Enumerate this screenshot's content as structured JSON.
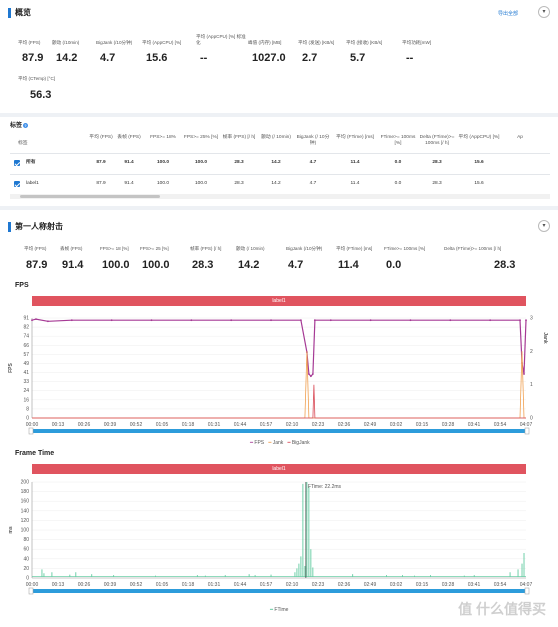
{
  "overview": {
    "title": "概览",
    "export_label": "导出全部",
    "metrics_row1": [
      {
        "label": "平均 (FPS)",
        "value": "87.9"
      },
      {
        "label": "颤动 (/10min)",
        "value": "14.2"
      },
      {
        "label": "BigJank (/10分钟)",
        "value": "4.7"
      },
      {
        "label": "平均 (AppCPU) [%]",
        "value": "15.6"
      },
      {
        "label": "平均 (AppCPU) [%] 标准化",
        "value": "--"
      },
      {
        "label": "峰值 (内存) [MB]",
        "value": "1027.0"
      },
      {
        "label": "平均 (发送) [KB/s]",
        "value": "2.7"
      },
      {
        "label": "平均 (接收) [KB/s]",
        "value": "5.7"
      },
      {
        "label": "平均功耗[mW]",
        "value": "--"
      }
    ],
    "metrics_row2": [
      {
        "label": "平均 (CTemp) [°C]",
        "value": "56.3"
      }
    ]
  },
  "tags": {
    "title": "标签",
    "headers": [
      "标签",
      "平均 (FPS)",
      "丢帧 (FPS)",
      "FPS>= 18%",
      "FPS>= 25% [%]",
      "帧率 (FPS) [/ h]",
      "颤动 (/ 10min)",
      "BigJank (/ 10分钟)",
      "平均 (FTime) [ms]",
      "FTime>= 100ms [%]",
      "Delta (FTime)>= 100ms [/ h]",
      "平均 (AppCPU) [%]",
      "Ap"
    ],
    "rows": [
      {
        "label": "所有",
        "bold": true,
        "cells": [
          "87.9",
          "91.4",
          "100.0",
          "100.0",
          "28.3",
          "14.2",
          "4.7",
          "11.4",
          "0.0",
          "28.3",
          "15.6"
        ]
      },
      {
        "label": "label1",
        "bold": false,
        "cells": [
          "87.9",
          "91.4",
          "100.0",
          "100.0",
          "28.3",
          "14.2",
          "4.7",
          "11.4",
          "0.0",
          "28.3",
          "15.6"
        ]
      }
    ]
  },
  "session": {
    "title": "第一人称射击",
    "metrics": [
      {
        "label": "平均 (FPS)",
        "value": "87.9"
      },
      {
        "label": "丢帧 (FPS)",
        "value": "91.4"
      },
      {
        "label": "FPS>= 18 [%]",
        "value": "100.0"
      },
      {
        "label": "FPS>= 25 [%]",
        "value": "100.0"
      },
      {
        "label": "帧率 (FPS) [/ h]",
        "value": "28.3"
      },
      {
        "label": "颤动 (/ 10min)",
        "value": "14.2"
      },
      {
        "label": "BigJank (/10分钟)",
        "value": "4.7"
      },
      {
        "label": "平均 (FTime) [ms]",
        "value": "11.4"
      },
      {
        "label": "FTime>= 100ms [%]",
        "value": "0.0"
      },
      {
        "label": "Delta (FTime)>= 100ms [/ h]",
        "value": "28.3"
      }
    ]
  },
  "chart_data": [
    {
      "type": "line",
      "title": "FPS",
      "banner": "label1",
      "ylabel": "FPS",
      "ylabel_right": "Jank",
      "yticks": [
        "0",
        "8",
        "16",
        "24",
        "33",
        "41",
        "49",
        "57",
        "66",
        "74",
        "82",
        "91"
      ],
      "yticks_right": [
        "0",
        "1",
        "2",
        "3"
      ],
      "xticks": [
        "00:00",
        "00:13",
        "00:26",
        "00:39",
        "00:52",
        "01:05",
        "01:18",
        "01:31",
        "01:44",
        "01:57",
        "02:10",
        "02:23",
        "02:36",
        "02:49",
        "03:02",
        "03:15",
        "03:28",
        "03:41",
        "03:54",
        "04:07"
      ],
      "series": [
        {
          "name": "FPS",
          "color": "#a63a95",
          "points": [
            [
              0,
              89
            ],
            [
              2,
              90
            ],
            [
              8,
              88
            ],
            [
              20,
              89
            ],
            [
              40,
              89
            ],
            [
              60,
              89
            ],
            [
              80,
              89
            ],
            [
              100,
              89
            ],
            [
              120,
              89
            ],
            [
              135,
              89
            ],
            [
              138,
              60
            ],
            [
              139,
              40
            ],
            [
              140,
              38
            ],
            [
              141,
              40
            ],
            [
              142,
              89
            ],
            [
              150,
              89
            ],
            [
              170,
              89
            ],
            [
              190,
              89
            ],
            [
              210,
              89
            ],
            [
              230,
              89
            ],
            [
              245,
              89
            ],
            [
              246,
              50
            ],
            [
              247,
              40
            ],
            [
              248,
              89
            ]
          ]
        },
        {
          "name": "Jank",
          "color": "#f0a050",
          "points": [
            [
              0,
              0
            ],
            [
              137,
              0
            ],
            [
              138,
              2
            ],
            [
              139,
              0
            ],
            [
              145,
              0
            ],
            [
              245,
              0
            ],
            [
              246,
              2
            ],
            [
              247,
              0
            ],
            [
              248,
              0
            ]
          ]
        },
        {
          "name": "BigJank",
          "color": "#d94b57",
          "points": [
            [
              0,
              0
            ],
            [
              141,
              0
            ],
            [
              141.5,
              1
            ],
            [
              142,
              0
            ],
            [
              248,
              0
            ]
          ]
        }
      ]
    },
    {
      "type": "bar",
      "title": "Frame Time",
      "banner": "label1",
      "ylabel": "ms",
      "annotation": "FTime: 22.2ms",
      "yticks": [
        "0",
        "20",
        "40",
        "60",
        "80",
        "100",
        "120",
        "140",
        "160",
        "180",
        "200"
      ],
      "xticks": [
        "00:00",
        "00:13",
        "00:26",
        "00:39",
        "00:52",
        "01:05",
        "01:18",
        "01:31",
        "01:44",
        "01:57",
        "02:10",
        "02:23",
        "02:36",
        "02:49",
        "03:02",
        "03:15",
        "03:28",
        "03:41",
        "03:54",
        "04:07"
      ],
      "series": [
        {
          "name": "FTime",
          "color": "#4dc494",
          "values": [
            [
              5,
              18
            ],
            [
              6,
              10
            ],
            [
              10,
              12
            ],
            [
              19,
              7
            ],
            [
              22,
              12
            ],
            [
              30,
              8
            ],
            [
              41,
              6
            ],
            [
              62,
              5
            ],
            [
              83,
              6
            ],
            [
              87,
              5
            ],
            [
              97,
              6
            ],
            [
              109,
              8
            ],
            [
              112,
              6
            ],
            [
              120,
              7
            ],
            [
              132,
              12
            ],
            [
              133,
              20
            ],
            [
              134,
              30
            ],
            [
              135,
              45
            ],
            [
              136,
              196
            ],
            [
              137,
              25
            ],
            [
              138,
              200
            ],
            [
              139,
              190
            ],
            [
              140,
              60
            ],
            [
              141,
              22
            ],
            [
              161,
              8
            ],
            [
              178,
              6
            ],
            [
              186,
              6
            ],
            [
              192,
              5
            ],
            [
              200,
              6
            ],
            [
              217,
              5
            ],
            [
              222,
              6
            ],
            [
              240,
              12
            ],
            [
              244,
              18
            ],
            [
              246,
              30
            ],
            [
              247,
              52
            ]
          ]
        }
      ]
    }
  ],
  "fps_legend": [
    "FPS",
    "Jank",
    "BigJank"
  ],
  "ftime_legend": [
    "FTime"
  ],
  "watermark": "值 什么值得买"
}
